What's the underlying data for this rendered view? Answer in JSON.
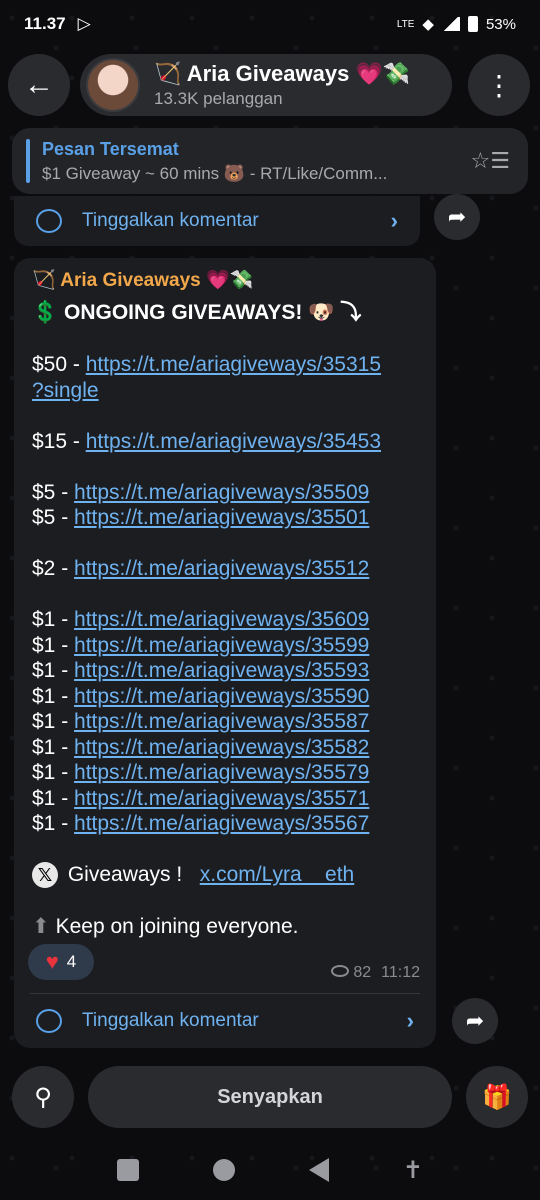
{
  "status": {
    "time": "11.37",
    "battery": "53%",
    "network": "LTE"
  },
  "header": {
    "channel_title": "🏹 Aria Giveaways 💗💸",
    "subscribers": "13.3K pelanggan"
  },
  "pinned": {
    "title": "Pesan Tersemat",
    "preview": "$1 Giveaway ~ 60 mins 🐻 - RT/Like/Comm..."
  },
  "prev_comment": {
    "label": "Tinggalkan komentar"
  },
  "message": {
    "channel_name": "🏹 Aria Giveaways 💗💸",
    "headline": "💲 ONGOING GIVEAWAYS! 🐶 ⤵",
    "lines": [
      {
        "prefix": "$50 - ",
        "link": "https://t.me/ariagiveways/35315"
      },
      {
        "prefix": "",
        "link": "?single"
      },
      {
        "gap": true
      },
      {
        "prefix": "$15 - ",
        "link": "https://t.me/ariagiveways/35453"
      },
      {
        "gap": true
      },
      {
        "prefix": "$5 - ",
        "link": "https://t.me/ariagiveways/35509"
      },
      {
        "prefix": "$5 - ",
        "link": "https://t.me/ariagiveways/35501"
      },
      {
        "gap": true
      },
      {
        "prefix": "$2 - ",
        "link": "https://t.me/ariagiveways/35512"
      },
      {
        "gap": true
      },
      {
        "prefix": "$1 - ",
        "link": "https://t.me/ariagiveways/35609"
      },
      {
        "prefix": "$1 - ",
        "link": "https://t.me/ariagiveways/35599"
      },
      {
        "prefix": "$1 - ",
        "link": "https://t.me/ariagiveways/35593"
      },
      {
        "prefix": "$1 - ",
        "link": "https://t.me/ariagiveways/35590"
      },
      {
        "prefix": "$1 - ",
        "link": "https://t.me/ariagiveways/35587"
      },
      {
        "prefix": "$1 - ",
        "link": "https://t.me/ariagiveways/35582"
      },
      {
        "prefix": "$1 - ",
        "link": "https://t.me/ariagiveways/35579"
      },
      {
        "prefix": "$1 - ",
        "link": "https://t.me/ariagiveways/35571"
      },
      {
        "prefix": "$1 - ",
        "link": "https://t.me/ariagiveways/35567"
      },
      {
        "gap": true
      }
    ],
    "x_line": {
      "text": "Giveaways !",
      "link": "x.com/Lyra__eth"
    },
    "footer_line": "Keep on joining everyone.",
    "reaction_count": "4",
    "views": "82",
    "time": "11:12",
    "comment_label": "Tinggalkan komentar"
  },
  "bottom": {
    "mute_label": "Senyapkan"
  }
}
